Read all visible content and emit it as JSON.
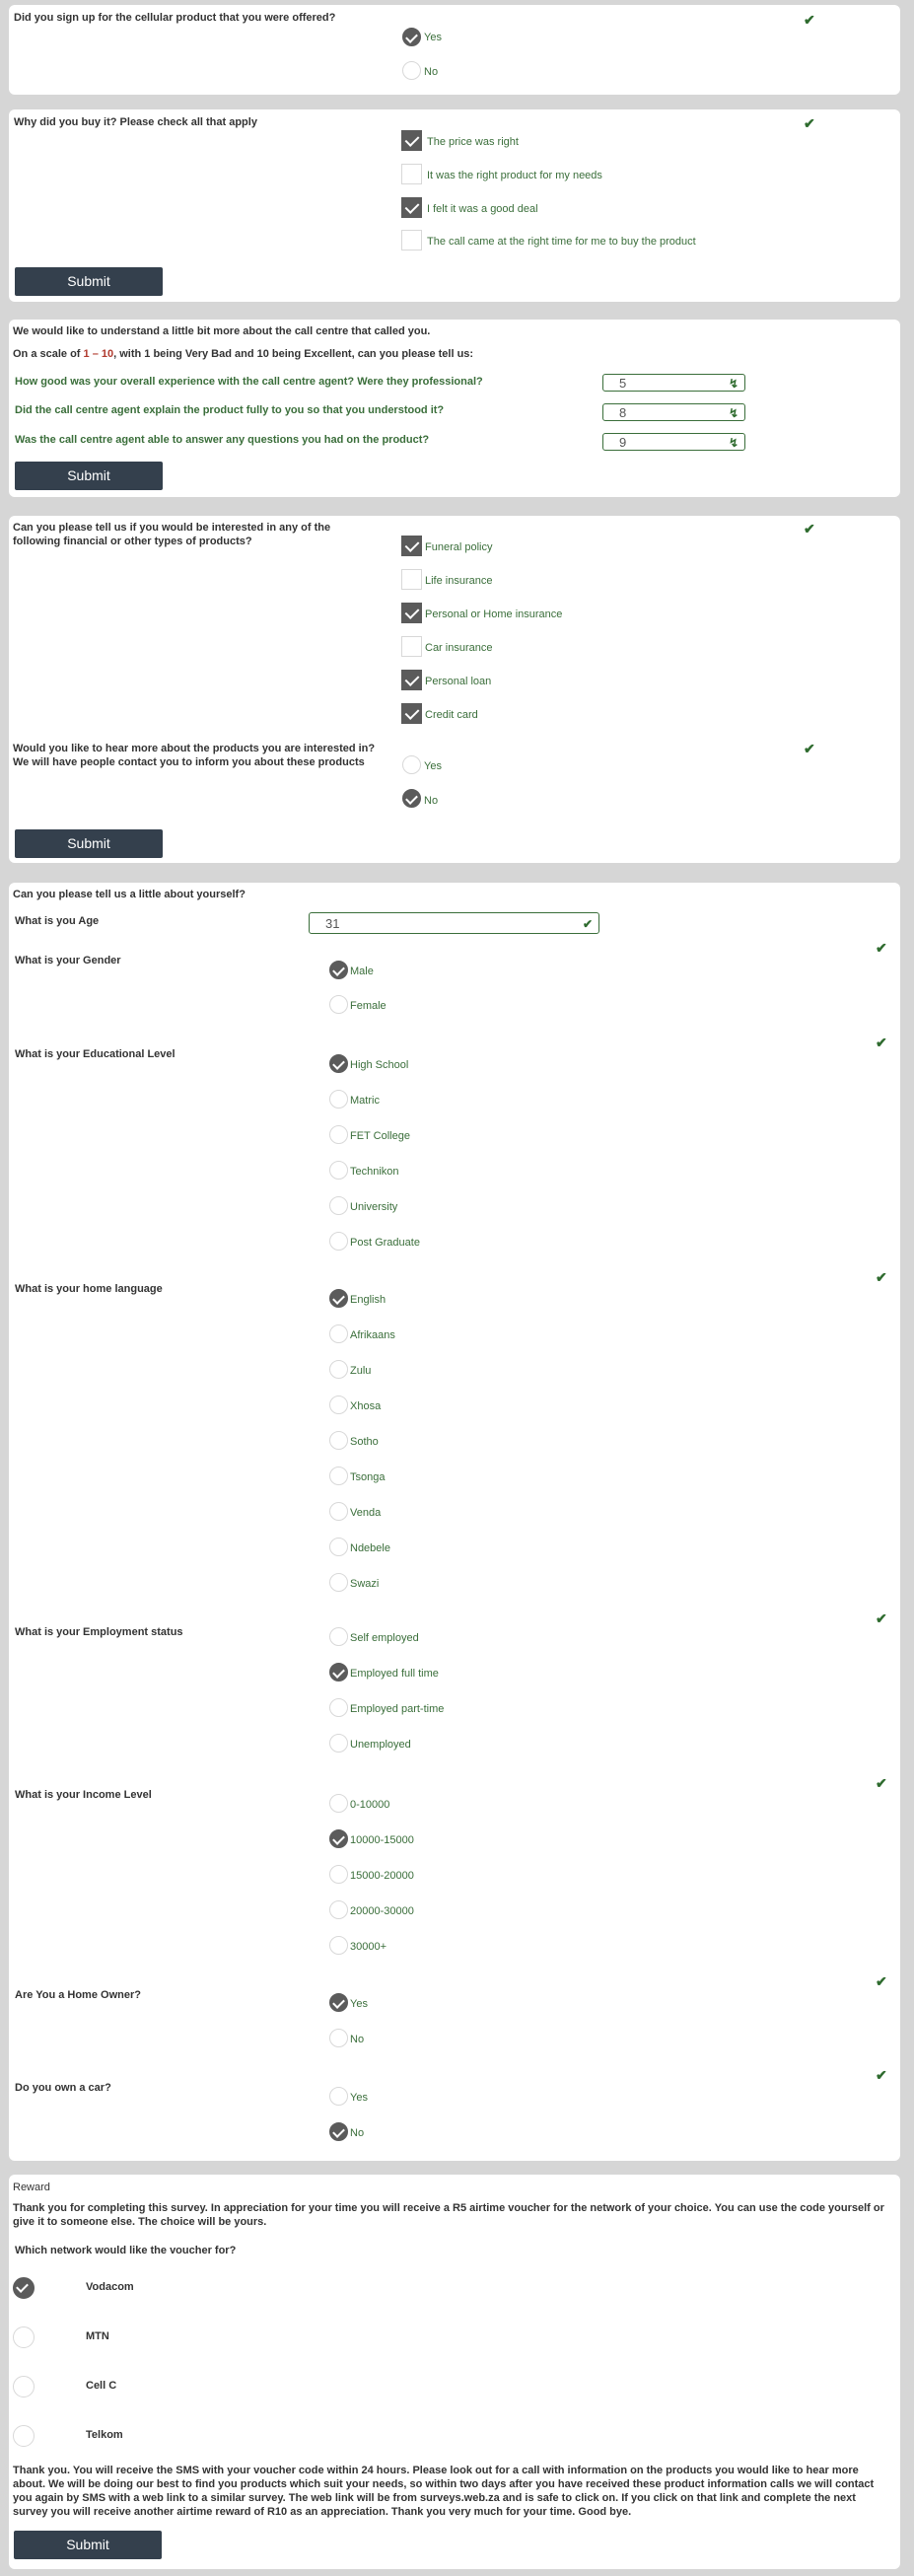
{
  "q1": {
    "question": "Did you sign up for the cellular product that you were offered?",
    "options": [
      "Yes",
      "No"
    ],
    "selected": "Yes"
  },
  "q2": {
    "question": "Why did you buy it? Please check all that apply",
    "options": [
      "The price was right",
      "It was the right product for my needs",
      "I felt it was a good deal",
      "The call came at the right time for me to buy the product"
    ],
    "checked": [
      "The price was right",
      "I felt it was a good deal"
    ]
  },
  "submit_label": "Submit",
  "rating": {
    "intro": "We would like to understand a little bit more about the call centre that called you.",
    "scale_prefix": "On a scale of ",
    "scale_range": "1 – 10",
    "scale_mid": ", with 1 being Very Bad and 10 being Excellent, can you please tell us:",
    "items": [
      {
        "q": "How good was your overall experience with the call centre agent? Were they professional?",
        "value": "5"
      },
      {
        "q": "Did the call centre agent explain the product fully to you so that you understood it?",
        "value": "8"
      },
      {
        "q": "Was the call centre agent able to answer any questions you had on the product?",
        "value": "9"
      }
    ]
  },
  "interest": {
    "question_line1": "Can you please tell us if you would be interested in any of the",
    "question_line2": "following financial or other types of products?",
    "options": [
      "Funeral policy",
      "Life insurance",
      "Personal or Home insurance",
      "Car insurance",
      "Personal loan",
      "Credit card"
    ],
    "checked": [
      "Funeral policy",
      "Personal or Home insurance",
      "Personal loan",
      "Credit card"
    ],
    "contact_line1": "Would you like to hear more about the products you are interested in?",
    "contact_line2": "We will have people contact you to inform you about these products",
    "contact_options": [
      "Yes",
      "No"
    ],
    "contact_selected": "No"
  },
  "about": {
    "heading": "Can you please tell us a little about yourself?",
    "age_label": "What is you Age",
    "age_value": "31",
    "gender": {
      "label": "What is your Gender",
      "options": [
        "Male",
        "Female"
      ],
      "selected": "Male"
    },
    "education": {
      "label": "What is your Educational Level",
      "options": [
        "High School",
        "Matric",
        "FET College",
        "Technikon",
        "University",
        "Post Graduate"
      ],
      "selected": "High School"
    },
    "language": {
      "label": "What is your home language",
      "options": [
        "English",
        "Afrikaans",
        "Zulu",
        "Xhosa",
        "Sotho",
        "Tsonga",
        "Venda",
        "Ndebele",
        "Swazi"
      ],
      "selected": "English"
    },
    "employment": {
      "label": "What is your Employment status",
      "options": [
        "Self employed",
        "Employed full time",
        "Employed part-time",
        "Unemployed"
      ],
      "selected": "Employed full time"
    },
    "income": {
      "label": "What is your Income Level",
      "options": [
        "0-10000",
        "10000-15000",
        "15000-20000",
        "20000-30000",
        "30000+"
      ],
      "selected": "10000-15000"
    },
    "home": {
      "label": "Are You a Home Owner?",
      "options": [
        "Yes",
        "No"
      ],
      "selected": "Yes"
    },
    "car": {
      "label": "Do you own a car?",
      "options": [
        "Yes",
        "No"
      ],
      "selected": "No"
    }
  },
  "reward": {
    "title": "Reward",
    "para1": "Thank you for completing this survey. In appreciation for your time you will receive a R5 airtime voucher for the network of your choice. You can use the code yourself or give it to someone else. The choice will be yours.",
    "network_question": "Which network would like the voucher for?",
    "networks": [
      "Vodacom",
      "MTN",
      "Cell C",
      "Telkom"
    ],
    "selected": "Vodacom",
    "para2": "Thank you. You will receive the SMS with your voucher code within 24 hours. Please look out for a call with information on the products you would like to hear more about. We will be doing our best to find you products which suit your needs, so within two days after you have received these product information calls we will contact you again by SMS with a web link to a similar survey. The web link will be from surveys.web.za and is safe to click on. If you click on that link and complete the next survey you will receive another airtime reward of R10 as an appreciation. Thank you very much for your time. Good bye."
  }
}
